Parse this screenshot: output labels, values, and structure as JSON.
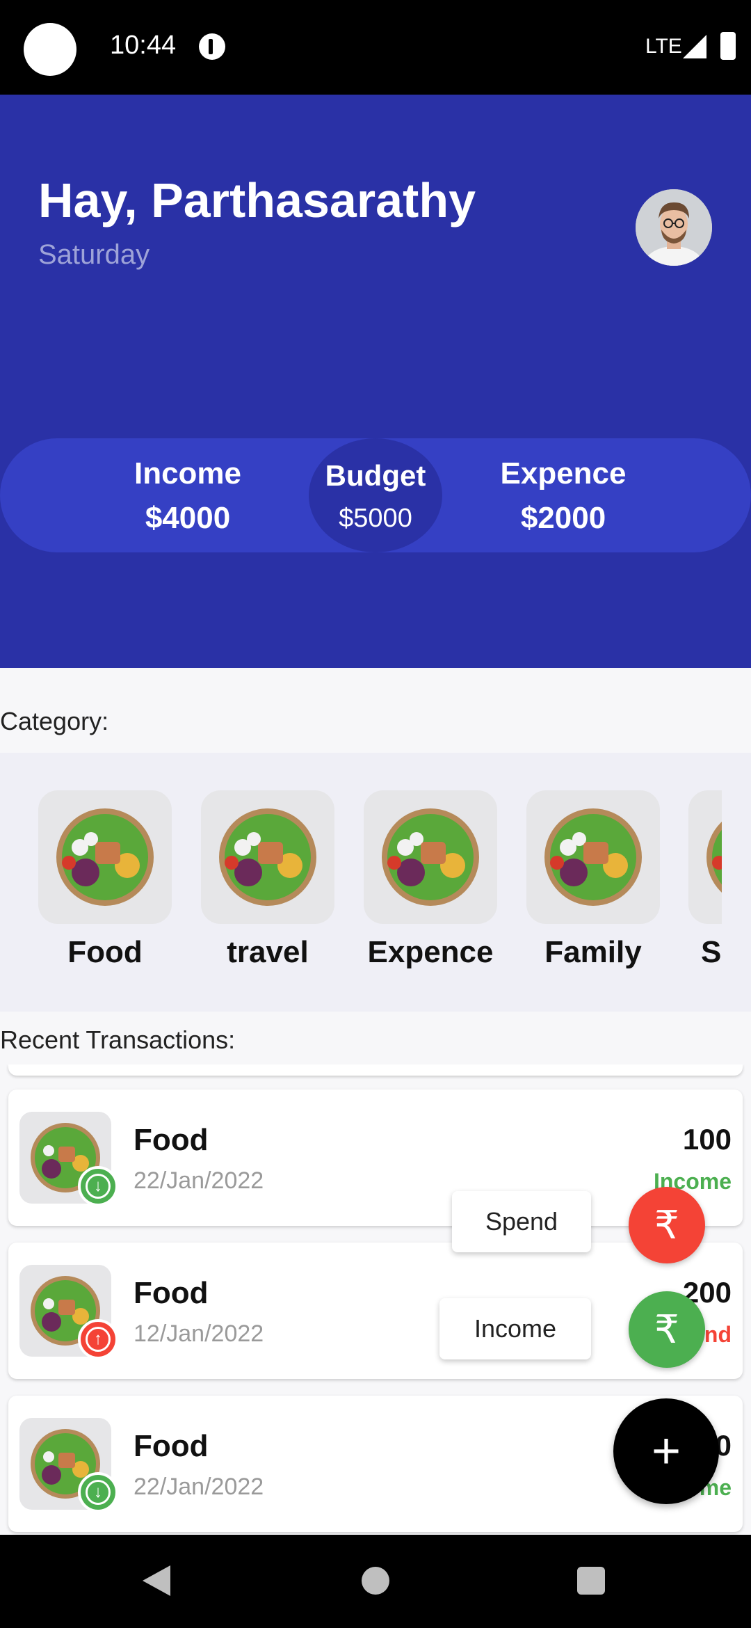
{
  "status_bar": {
    "time": "10:44",
    "network": "LTE"
  },
  "header": {
    "greeting": "Hay, Parthasarathy",
    "day": "Saturday"
  },
  "summary": {
    "income_label": "Income",
    "income_value": "$4000",
    "budget_label": "Budget",
    "budget_value": "$5000",
    "expense_label": "Expence",
    "expense_value": "$2000"
  },
  "category": {
    "title": "Category:",
    "items": [
      {
        "name": "Food"
      },
      {
        "name": "travel"
      },
      {
        "name": "Expence"
      },
      {
        "name": "Family"
      },
      {
        "name": "Sa"
      }
    ]
  },
  "transactions": {
    "title": "Recent Transactions:",
    "items": [
      {
        "title": "Food",
        "date": "22/Jan/2022",
        "amount": "100",
        "type": "Income",
        "icon": "arrow-down-icon"
      },
      {
        "title": "Food",
        "date": "12/Jan/2022",
        "amount": "200",
        "type": "Spend",
        "icon": "arrow-up-icon"
      },
      {
        "title": "Food",
        "date": "22/Jan/2022",
        "amount": "0",
        "type": "Income",
        "icon": "arrow-down-icon"
      }
    ]
  },
  "fab_menu": {
    "spend_label": "Spend",
    "income_label": "Income",
    "currency_glyph": "₹",
    "main_glyph": "+"
  },
  "colors": {
    "header_bg": "#2a31a6",
    "summary_bg": "#3540c4",
    "income_green": "#4caf50",
    "spend_red": "#f44336"
  }
}
